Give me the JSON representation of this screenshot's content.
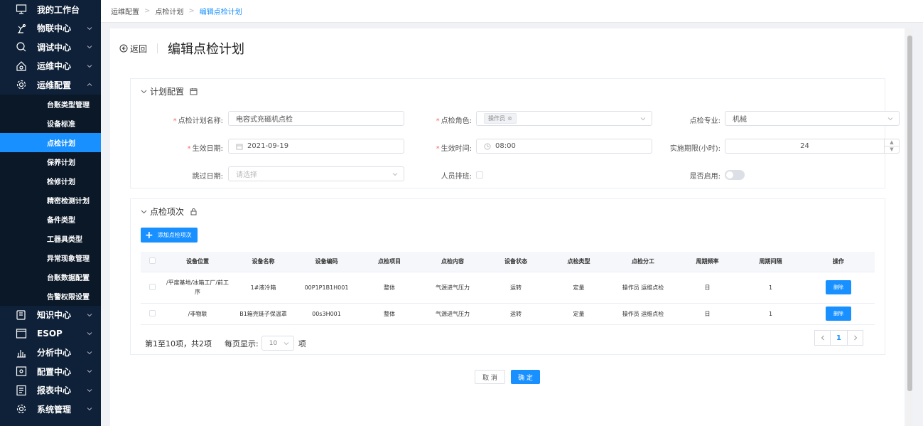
{
  "sidebar": {
    "items": [
      {
        "label": "我的工作台",
        "icon": "monitor-icon",
        "chevron": ""
      },
      {
        "label": "物联中心",
        "icon": "robot-arm-icon",
        "chevron": "down"
      },
      {
        "label": "调试中心",
        "icon": "debug-search-icon",
        "chevron": "down"
      },
      {
        "label": "运维中心",
        "icon": "home-cog-icon",
        "chevron": "down"
      },
      {
        "label": "运维配置",
        "icon": "gear-icon",
        "chevron": "up"
      }
    ],
    "submenu": [
      {
        "label": "台账类型管理"
      },
      {
        "label": "设备标准"
      },
      {
        "label": "点检计划",
        "active": true
      },
      {
        "label": "保养计划"
      },
      {
        "label": "检修计划"
      },
      {
        "label": "精密检测计划"
      },
      {
        "label": "备件类型"
      },
      {
        "label": "工器具类型"
      },
      {
        "label": "异常现象管理"
      },
      {
        "label": "台账数据配置"
      },
      {
        "label": "告警权限设置"
      }
    ],
    "bottom_items": [
      {
        "label": "知识中心",
        "icon": "book-icon"
      },
      {
        "label": "ESOP",
        "icon": "esop-icon"
      },
      {
        "label": "分析中心",
        "icon": "bar-chart-icon"
      },
      {
        "label": "配置中心",
        "icon": "config-icon"
      },
      {
        "label": "报表中心",
        "icon": "report-icon"
      },
      {
        "label": "系统管理",
        "icon": "settings-icon"
      }
    ]
  },
  "breadcrumb": [
    "运维配置",
    "点检计划",
    "编辑点检计划"
  ],
  "header": {
    "back_label": "返回",
    "title": "编辑点检计划"
  },
  "plan_config": {
    "title": "计划配置",
    "plan_name_label": "点检计划名称:",
    "plan_name_value": "电容式充磁机点检",
    "role_label": "点检角色:",
    "role_tag": "操作员",
    "specialty_label": "点检专业:",
    "specialty_value": "机械",
    "effective_date_label": "生效日期:",
    "effective_date_value": "2021-09-19",
    "effective_time_label": "生效时间:",
    "effective_time_value": "08:00",
    "deadline_label": "实施期限(小时):",
    "deadline_value": "24",
    "skip_date_label": "跳过日期:",
    "skip_date_placeholder": "请选择",
    "scheduling_label": "人员排班:",
    "enabled_label": "是否启用:"
  },
  "items_section": {
    "title": "点检项次",
    "add_button": "添加点检项次",
    "columns": [
      "设备位置",
      "设备名称",
      "设备编码",
      "点检项目",
      "点检内容",
      "设备状态",
      "点检类型",
      "点检分工",
      "周期频率",
      "周期间隔",
      "操作"
    ],
    "rows": [
      {
        "location": "/平度基地/冰箱工厂/前工序",
        "name": "1#液冷箱",
        "code": "00P1P1B1H001",
        "item": "整体",
        "content": "气源进气压力",
        "status": "运转",
        "type": "定量",
        "division": "操作员 运维点检",
        "frequency": "日",
        "interval": "1",
        "action": "删除"
      },
      {
        "location": "/非物联",
        "name": "B1箱壳链子保温罩",
        "code": "00s3H001",
        "item": "整体",
        "content": "气源进气压力",
        "status": "运转",
        "type": "定量",
        "division": "操作员 运维点检",
        "frequency": "日",
        "interval": "1",
        "action": "删除"
      }
    ],
    "pager": {
      "summary": "第1至10项，共2项",
      "per_page_label": "每页显示:",
      "per_page_value": "10",
      "unit": "项",
      "current_page": "1"
    }
  },
  "footer": {
    "cancel": "取 消",
    "ok": "确 定"
  },
  "colors": {
    "sidebar_bg": "#0f2138",
    "accent": "#1890ff",
    "required": "#f56c6c"
  }
}
